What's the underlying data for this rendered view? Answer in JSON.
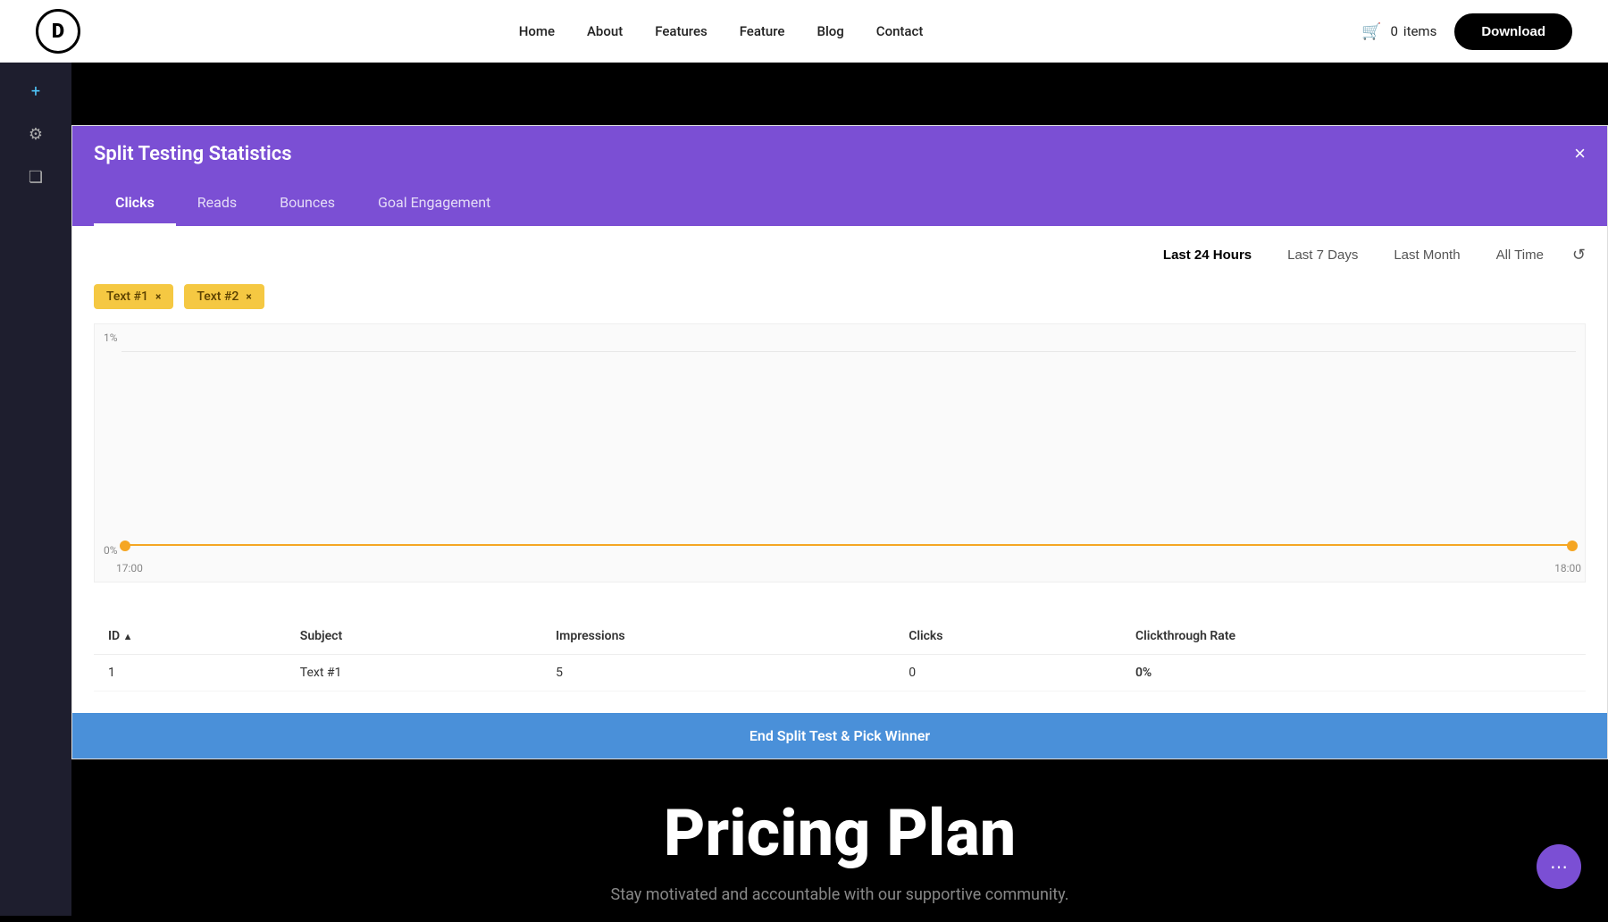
{
  "navbar": {
    "logo_letter": "D",
    "nav_items": [
      {
        "label": "Home",
        "active": true
      },
      {
        "label": "About"
      },
      {
        "label": "Features"
      },
      {
        "label": "Feature"
      },
      {
        "label": "Blog"
      },
      {
        "label": "Contact"
      }
    ],
    "cart_count": "0",
    "cart_label": "items",
    "download_label": "Download"
  },
  "modal": {
    "title": "Split Testing Statistics",
    "close_label": "×",
    "tabs": [
      {
        "label": "Clicks",
        "active": true
      },
      {
        "label": "Reads"
      },
      {
        "label": "Bounces"
      },
      {
        "label": "Goal Engagement"
      }
    ]
  },
  "time_range": {
    "options": [
      {
        "label": "Last 24 Hours",
        "active": true
      },
      {
        "label": "Last 7 Days"
      },
      {
        "label": "Last Month"
      },
      {
        "label": "All Time"
      }
    ],
    "refresh_icon": "↺"
  },
  "filter_tags": [
    {
      "label": "Text #1"
    },
    {
      "label": "Text #2"
    }
  ],
  "chart": {
    "y_top_label": "1%",
    "y_bottom_label": "0%",
    "x_left_label": "17:00",
    "x_right_label": "18:00"
  },
  "table": {
    "columns": [
      {
        "label": "ID",
        "sortable": true,
        "sort_dir": "asc"
      },
      {
        "label": "Subject"
      },
      {
        "label": "Impressions"
      },
      {
        "label": "Clicks"
      },
      {
        "label": "Clickthrough Rate"
      }
    ],
    "rows": [
      {
        "id": "1",
        "subject": "Text #1",
        "impressions": "5",
        "clicks": "0",
        "clickthrough_rate": "0%"
      }
    ]
  },
  "end_split_label": "End Split Test & Pick Winner",
  "pricing": {
    "title": "Pricing Plan",
    "subtitle": "Stay motivated and accountable with our supportive community."
  },
  "float_btn": {
    "icon": "⋯"
  },
  "sidebar": {
    "icons": [
      {
        "name": "plus-icon",
        "symbol": "+",
        "active": true
      },
      {
        "name": "settings-icon",
        "symbol": "⚙"
      },
      {
        "name": "layers-icon",
        "symbol": "❏"
      }
    ]
  }
}
